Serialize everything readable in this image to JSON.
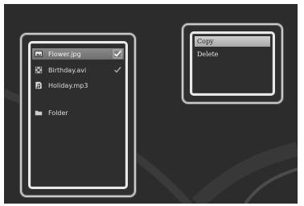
{
  "file_list": {
    "items": [
      {
        "label": "Flower.jpg",
        "icon": "image-file-icon",
        "checked": true,
        "selected": true
      },
      {
        "label": "Birthday.avi",
        "icon": "video-file-icon",
        "checked": true,
        "selected": false
      },
      {
        "label": "Holiday.mp3",
        "icon": "audio-file-icon",
        "checked": false,
        "selected": false
      },
      {
        "label": "Folder",
        "icon": "folder-icon",
        "checked": false,
        "selected": false
      }
    ]
  },
  "context_menu": {
    "items": [
      {
        "label": "Copy",
        "selected": true
      },
      {
        "label": "Delete",
        "selected": false
      }
    ]
  },
  "colors": {
    "background": "#2c2c2c",
    "panel_border": "#e8e8e8",
    "selection": "#8a8a8a"
  }
}
